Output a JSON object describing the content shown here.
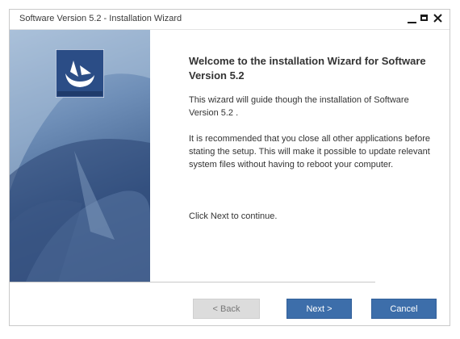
{
  "window": {
    "title": "Software Version 5.2 - Installation Wizard"
  },
  "content": {
    "heading": "Welcome to the installation Wizard for Software Version 5.2",
    "paragraph1": "This wizard will guide though the installation of Software Version 5.2 .",
    "paragraph2": "It is recommended that you close all other applications before stating the setup. This will make it possible to update relevant system files without having to reboot your computer.",
    "paragraph3": "Click Next to continue."
  },
  "buttons": {
    "back": "< Back",
    "next": "Next >",
    "cancel": "Cancel"
  },
  "icons": {
    "logo": "app-logo-icon",
    "minimize": "minimize-icon",
    "maximize": "maximize-icon",
    "close": "close-icon"
  },
  "colors": {
    "primary_button": "#3d6eaa",
    "disabled_button": "#dcdcdc",
    "sidebar_dark": "#2f4a78",
    "sidebar_light": "#9fb7d4"
  }
}
